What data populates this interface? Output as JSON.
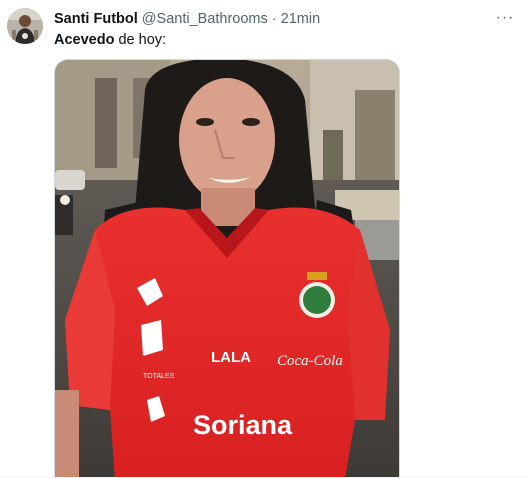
{
  "tweet": {
    "author_name": "Santi Futbol",
    "author_handle": "@Santi_Bathrooms",
    "separator": "·",
    "time": "21min",
    "text_strong": "Acevedo",
    "text_rest": " de hoy:",
    "more_icon": "more-dots-icon",
    "more_glyph": "···"
  },
  "media": {
    "shirt_texts": {
      "sponsor_main": "Soriana",
      "sponsor_cola": "Coca-Cola",
      "sponsor_small": "LALA",
      "brand_small": "TOTALES"
    }
  }
}
